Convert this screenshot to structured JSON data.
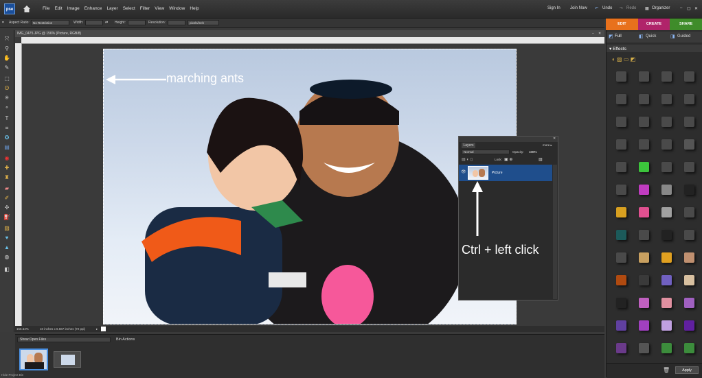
{
  "app": {
    "logo_text": "pse"
  },
  "menu": [
    "File",
    "Edit",
    "Image",
    "Enhance",
    "Layer",
    "Select",
    "Filter",
    "View",
    "Window",
    "Help"
  ],
  "account": {
    "sign_in": "Sign In",
    "join_now": "Join Now",
    "undo": "Undo",
    "redo": "Redo",
    "organizer": "Organizer"
  },
  "options": {
    "aspect_ratio_label": "Aspect Ratio:",
    "aspect_ratio_value": "No Restriction",
    "width_label": "Width:",
    "height_label": "Height:",
    "resolution_label": "Resolution:",
    "resolution_unit": "pixels/inch"
  },
  "mode_tabs": [
    {
      "label": "EDIT",
      "color": "#e8711c"
    },
    {
      "label": "CREATE",
      "color": "#b0246a"
    },
    {
      "label": "SHARE",
      "color": "#3f8c2a"
    }
  ],
  "sub_tabs": [
    "Full",
    "Quick",
    "Guided"
  ],
  "document": {
    "title": "IMG_0475.JPG @ 156% (Picture, RGB/8)",
    "zoom": "156.64%",
    "info": "10 inches x 6.667 inches (72 ppi)"
  },
  "annotations": {
    "marching": "marching ants",
    "ctrl": "Ctrl + left click"
  },
  "layers_panel": {
    "tab": "Layers",
    "more": "more ▸",
    "blend_mode": "Normal",
    "opacity_label": "Opacity:",
    "opacity_value": "100%",
    "lock_label": "Lock:",
    "layer_name": "Picture"
  },
  "effects_panel": {
    "title": "Effects",
    "apply": "Apply"
  },
  "bin": {
    "dropdown": "Show Open Files",
    "actions": "Bin Actions",
    "hide_label": "Hide Project Bin"
  },
  "colors": {
    "accent": "#e8711c",
    "panel_bg": "#2d2d2d",
    "selected_layer": "#1f4e8c"
  }
}
